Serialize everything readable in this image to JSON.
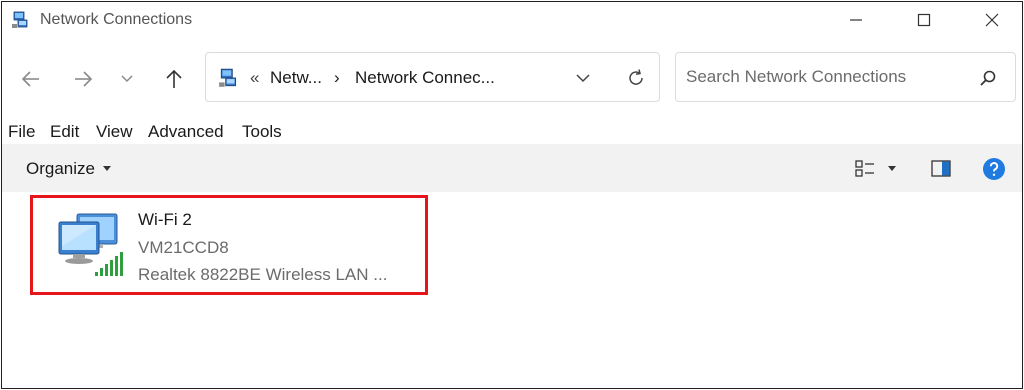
{
  "window": {
    "title": "Network Connections",
    "icon": "network-connections-icon"
  },
  "address": {
    "overflow": "«",
    "segment1": "Netw...",
    "separator": "›",
    "segment2": "Network Connec..."
  },
  "search": {
    "placeholder": "Search Network Connections"
  },
  "menu": [
    "File",
    "Edit",
    "View",
    "Advanced",
    "Tools"
  ],
  "command_bar": {
    "organize_label": "Organize",
    "change_view_icon": "view-options-icon",
    "preview_pane_icon": "preview-pane-icon",
    "help_icon": "help-icon"
  },
  "connection": {
    "name": "Wi-Fi 2",
    "network": "VM21CCD8",
    "adapter": "Realtek 8822BE Wireless LAN ...",
    "highlight_color": "#e8141b",
    "signal_color": "#2e9e3e"
  }
}
